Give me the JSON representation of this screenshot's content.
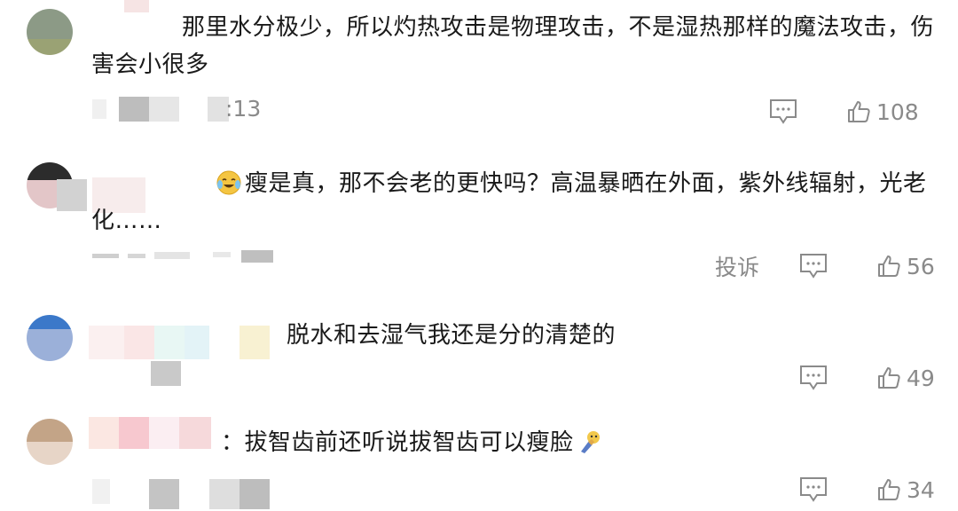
{
  "colors": {
    "text": "#1a1a1a",
    "meta": "#8a8a8a",
    "icon": "#8a8a8a"
  },
  "comments": [
    {
      "text": "那里水分极少，所以灼热攻击是物理攻击，不是湿热那样的魔法攻击，伤害会小很多",
      "time_visible": ":13",
      "likes": "108",
      "reply_icon": "comment-bubble-icon",
      "like_icon": "thumbs-up-icon"
    },
    {
      "emoji_icon": "tears-of-joy-emoji-icon",
      "text": "瘦是真，那不会老的更快吗？高温暴晒在外面，紫外线辐射，光老化……",
      "report_label": "投诉",
      "likes": "56",
      "reply_icon": "comment-bubble-icon",
      "like_icon": "thumbs-up-icon"
    },
    {
      "text": "脱水和去湿气我还是分的清楚的",
      "likes": "49",
      "reply_icon": "comment-bubble-icon",
      "like_icon": "thumbs-up-icon"
    },
    {
      "text": "：拔智齿前还听说拔智齿可以瘦脸",
      "emoji_icon": "doge-emoji-icon",
      "likes": "34",
      "reply_icon": "comment-bubble-icon",
      "like_icon": "thumbs-up-icon"
    }
  ]
}
